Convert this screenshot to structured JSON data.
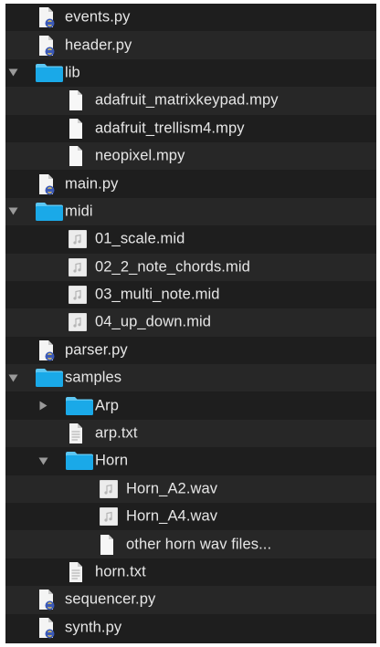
{
  "tree": [
    {
      "label": "events.py",
      "icon": "python-file-icon",
      "depth": 1,
      "disclosure": "none"
    },
    {
      "label": "header.py",
      "icon": "python-file-icon",
      "depth": 1,
      "disclosure": "none"
    },
    {
      "label": "lib",
      "icon": "folder-icon",
      "depth": 1,
      "disclosure": "expanded"
    },
    {
      "label": "adafruit_matrixkeypad.mpy",
      "icon": "file-icon",
      "depth": 2,
      "disclosure": "none"
    },
    {
      "label": "adafruit_trellism4.mpy",
      "icon": "file-icon",
      "depth": 2,
      "disclosure": "none"
    },
    {
      "label": "neopixel.mpy",
      "icon": "file-icon",
      "depth": 2,
      "disclosure": "none"
    },
    {
      "label": "main.py",
      "icon": "python-file-icon",
      "depth": 1,
      "disclosure": "none"
    },
    {
      "label": "midi",
      "icon": "folder-icon",
      "depth": 1,
      "disclosure": "expanded"
    },
    {
      "label": "01_scale.mid",
      "icon": "audio-file-icon",
      "depth": 2,
      "disclosure": "none"
    },
    {
      "label": "02_2_note_chords.mid",
      "icon": "audio-file-icon",
      "depth": 2,
      "disclosure": "none"
    },
    {
      "label": "03_multi_note.mid",
      "icon": "audio-file-icon",
      "depth": 2,
      "disclosure": "none"
    },
    {
      "label": "04_up_down.mid",
      "icon": "audio-file-icon",
      "depth": 2,
      "disclosure": "none"
    },
    {
      "label": "parser.py",
      "icon": "python-file-icon",
      "depth": 1,
      "disclosure": "none"
    },
    {
      "label": "samples",
      "icon": "folder-icon",
      "depth": 1,
      "disclosure": "expanded"
    },
    {
      "label": "Arp",
      "icon": "folder-icon",
      "depth": 2,
      "disclosure": "collapsed"
    },
    {
      "label": "arp.txt",
      "icon": "text-file-icon",
      "depth": 2,
      "disclosure": "none"
    },
    {
      "label": "Horn",
      "icon": "folder-icon",
      "depth": 2,
      "disclosure": "expanded"
    },
    {
      "label": "Horn_A2.wav",
      "icon": "audio-file-icon",
      "depth": 3,
      "disclosure": "none"
    },
    {
      "label": "Horn_A4.wav",
      "icon": "audio-file-icon",
      "depth": 3,
      "disclosure": "none"
    },
    {
      "label": "other horn wav files...",
      "icon": "file-icon",
      "depth": 3,
      "disclosure": "none"
    },
    {
      "label": "horn.txt",
      "icon": "text-file-icon",
      "depth": 2,
      "disclosure": "none"
    },
    {
      "label": "sequencer.py",
      "icon": "python-file-icon",
      "depth": 1,
      "disclosure": "none"
    },
    {
      "label": "synth.py",
      "icon": "python-file-icon",
      "depth": 1,
      "disclosure": "none"
    }
  ],
  "colors": {
    "background": "#1e1e1e",
    "row_alt": "#272727",
    "text": "#e6e6e6",
    "folder": "#1aa9e8",
    "folder_tab": "#5cc6f2",
    "disclosure": "#9a9a9a",
    "python_badge": "#3a59b8"
  }
}
